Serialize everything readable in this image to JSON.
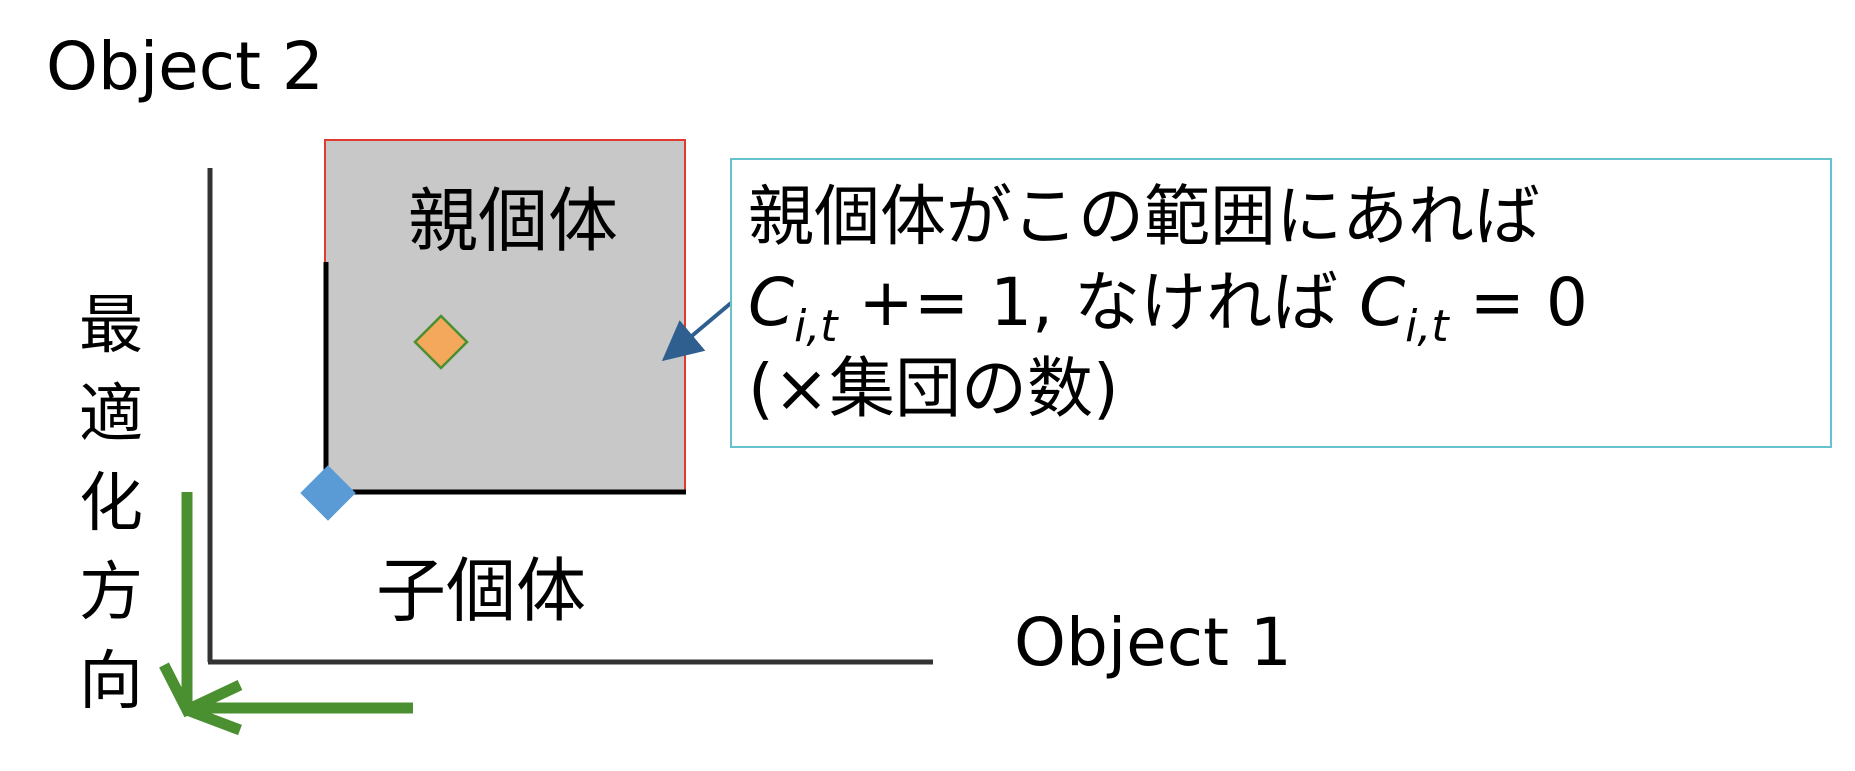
{
  "axes": {
    "y_label": "Object 2",
    "x_label": "Object 1"
  },
  "optimization_direction": {
    "chars": [
      "最",
      "適",
      "化",
      "方",
      "向"
    ],
    "arrow_color": "#4a9030"
  },
  "regions": {
    "parent_label": "親個体",
    "child_label": "子個体",
    "box_fill": "#c8c8c8",
    "box_border": "#e03b30"
  },
  "markers": {
    "parent_marker_color": "#f4a85c",
    "parent_marker_border": "#4a9030",
    "child_marker_color": "#5b9bd5"
  },
  "callout": {
    "line1": "親個体がこの範囲にあれば",
    "line2": {
      "var1": "C",
      "sub1": "i,t",
      "op1": " += 1, なければ ",
      "var2": "C",
      "sub2": "i,t",
      "op2": " = 0"
    },
    "line3": "(×集団の数)",
    "border_color": "#66c2cc",
    "pointer_color": "#2f5f8f"
  }
}
